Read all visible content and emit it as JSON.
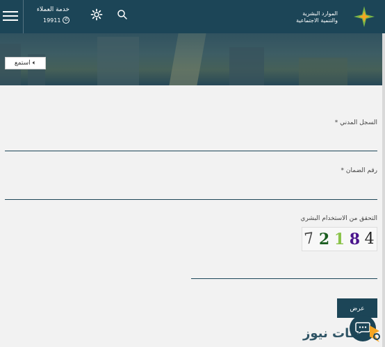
{
  "header": {
    "customer_service_label": "خدمة العملاء",
    "customer_service_phone": "19911",
    "logo_text_line1": "الموارد البشرية",
    "logo_text_line2": "والتنمية الاجتماعية"
  },
  "hero": {
    "listen_label": "استمع"
  },
  "form": {
    "civil_registry_label": "السجل المدني *",
    "civil_registry_value": "",
    "guarantee_number_label": "رقم الضمان *",
    "guarantee_number_value": "",
    "captcha_label": "التحقق من الاستخدام البشري",
    "captcha_digits": [
      "7",
      "2",
      "1",
      "8",
      "4"
    ],
    "captcha_value": "",
    "submit_label": "عرض"
  },
  "watermark": {
    "text": "لحظات نيوز"
  },
  "colors": {
    "primary": "#1c4557",
    "background": "#f2f2f2",
    "logo_green": "#7ab648",
    "logo_orange": "#f5a623"
  }
}
